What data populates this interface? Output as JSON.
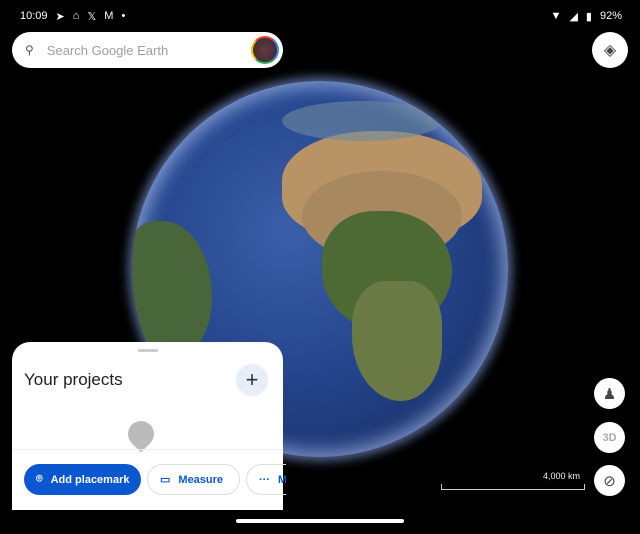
{
  "status_bar": {
    "time": "10:09",
    "battery": "92%",
    "icons": [
      "telegram-icon",
      "home-icon",
      "x-icon",
      "gmail-icon",
      "dot-icon",
      "wifi-icon",
      "signal-icon",
      "battery-icon"
    ]
  },
  "search": {
    "placeholder": "Search Google Earth"
  },
  "projects": {
    "title": "Your projects",
    "add_label": "+"
  },
  "actions": {
    "add_placemark": "Add placemark",
    "measure": "Measure",
    "more": "M"
  },
  "controls": {
    "three_d": "3D"
  },
  "scale": {
    "label": "4,000 km"
  },
  "colors": {
    "accent": "#0b57d0"
  }
}
